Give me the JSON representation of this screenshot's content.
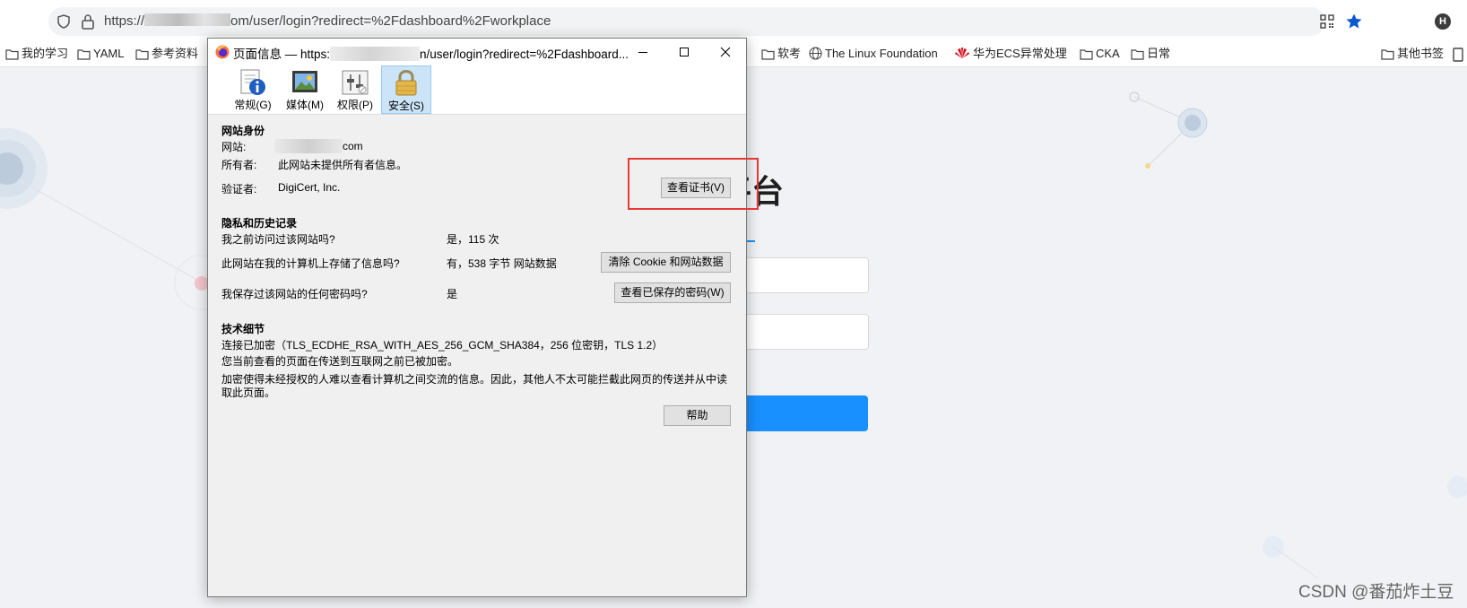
{
  "browser": {
    "url_prefix": "https://",
    "url_suffix": "om/user/login?redirect=%2Fdashboard%2Fworkplace",
    "profile_initial": "H",
    "accent": "#0b57d0"
  },
  "bookmarks": [
    {
      "label": "我的学习"
    },
    {
      "label": "YAML"
    },
    {
      "label": "参考资料"
    },
    {
      "label": "软考"
    },
    {
      "label": "The Linux Foundation"
    },
    {
      "label": "华为ECS异常处理"
    },
    {
      "label": "CKA"
    },
    {
      "label": "日常"
    },
    {
      "label": "其他书签"
    }
  ],
  "background_page": {
    "title_fragment": "理平台",
    "primary_color": "#1890ff"
  },
  "dialog": {
    "title_prefix": "页面信息 — https:",
    "title_suffix": "n/user/login?redirect=%2Fdashboard...",
    "tabs": [
      {
        "label": "常规(G)",
        "icon": "info-icon"
      },
      {
        "label": "媒体(M)",
        "icon": "media-icon"
      },
      {
        "label": "权限(P)",
        "icon": "permissions-icon"
      },
      {
        "label": "安全(S)",
        "icon": "lock-icon",
        "selected": true
      }
    ],
    "identity": {
      "heading": "网站身份",
      "website_label": "网站:",
      "website_value": "com",
      "owner_label": "所有者:",
      "owner_value": "此网站未提供所有者信息。",
      "verifier_label": "验证者:",
      "verifier_value": "DigiCert, Inc.",
      "view_cert_button": "查看证书(V)"
    },
    "privacy": {
      "heading": "隐私和历史记录",
      "q1": "我之前访问过该网站吗?",
      "a1": "是，115 次",
      "q2": "此网站在我的计算机上存储了信息吗?",
      "a2": "有，538 字节 网站数据",
      "clear_button": "清除 Cookie 和网站数据",
      "q3": "我保存过该网站的任何密码吗?",
      "a3": "是",
      "view_passwords_button": "查看已保存的密码(W)"
    },
    "technical": {
      "heading": "技术细节",
      "line1": "连接已加密（TLS_ECDHE_RSA_WITH_AES_256_GCM_SHA384，256 位密钥，TLS 1.2）",
      "line2": "您当前查看的页面在传送到互联网之前已被加密。",
      "line3": "加密使得未经授权的人难以查看计算机之间交流的信息。因此，其他人不太可能拦截此网页的传送并从中读",
      "line4": "取此页面。"
    },
    "help_button": "帮助",
    "highlight_color": "#e53935"
  },
  "watermark": "CSDN @番茄炸土豆"
}
